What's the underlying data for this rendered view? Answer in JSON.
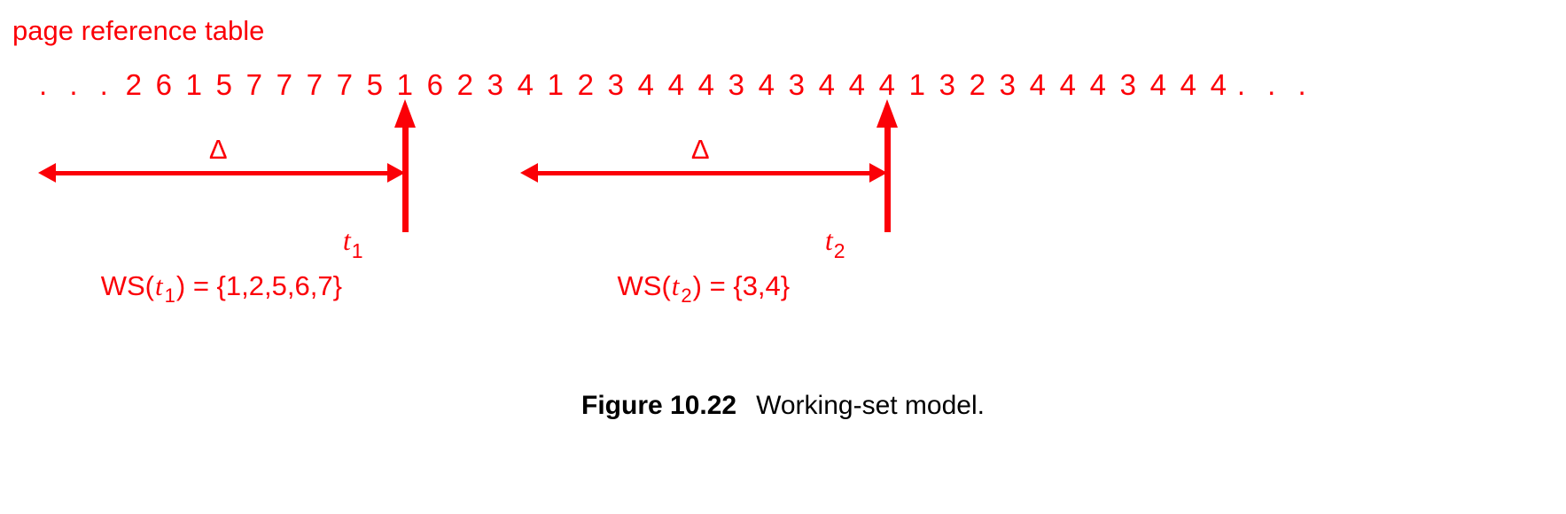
{
  "figure": {
    "title_label": "page reference table",
    "caption_label": "Figure 10.22",
    "caption_text": "Working-set model.",
    "accent_color": "#fb0007",
    "caption_color": "#000000",
    "background_color": "#ffffff"
  },
  "reference_string": {
    "leading_ellipsis": ". . .",
    "trailing_ellipsis": ". . .",
    "values": [
      "2",
      "6",
      "1",
      "5",
      "7",
      "7",
      "7",
      "7",
      "5",
      "1",
      "6",
      "2",
      "3",
      "4",
      "1",
      "2",
      "3",
      "4",
      "4",
      "4",
      "3",
      "4",
      "3",
      "4",
      "4",
      "4",
      "1",
      "3",
      "2",
      "3",
      "4",
      "4",
      "4",
      "3",
      "4",
      "4",
      "4"
    ]
  },
  "markers": [
    {
      "name": "t1",
      "time_label": "t",
      "time_subscript": "1",
      "delta_label": "Δ",
      "window_set_prefix": "WS(",
      "window_set_var": "t",
      "window_set_sub": "1",
      "window_set_middle": ") = {",
      "window_set_members": "1,2,5,6,7",
      "window_set_suffix": "}",
      "reference_index": 9,
      "reference_value": "1"
    },
    {
      "name": "t2",
      "time_label": "t",
      "time_subscript": "2",
      "delta_label": "Δ",
      "window_set_prefix": "WS(",
      "window_set_var": "t",
      "window_set_sub": "2",
      "window_set_middle": ") = {",
      "window_set_members": "3,4",
      "window_set_suffix": "}",
      "reference_index": 25,
      "reference_value": "4"
    }
  ]
}
